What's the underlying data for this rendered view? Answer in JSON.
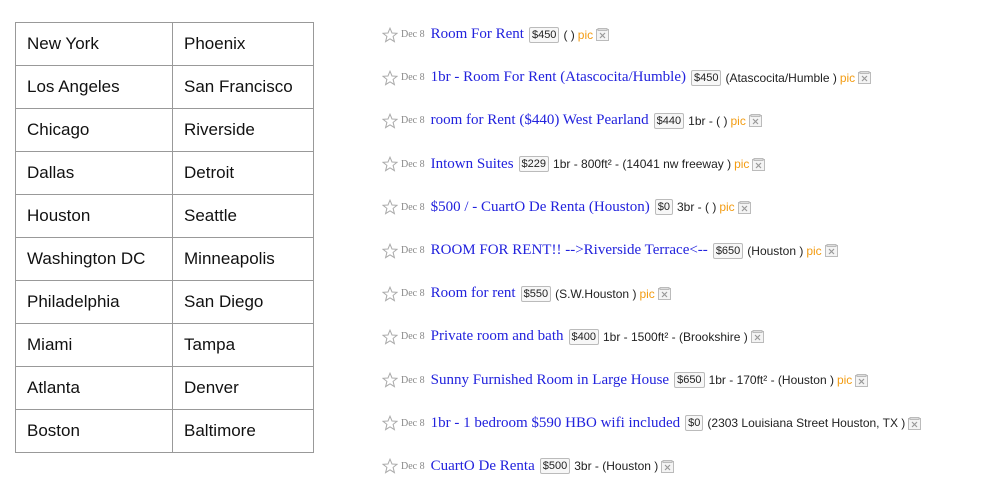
{
  "cities": [
    [
      "New York",
      "Phoenix"
    ],
    [
      "Los Angeles",
      "San Francisco"
    ],
    [
      "Chicago",
      "Riverside"
    ],
    [
      "Dallas",
      "Detroit"
    ],
    [
      "Houston",
      "Seattle"
    ],
    [
      "Washington DC",
      "Minneapolis"
    ],
    [
      "Philadelphia",
      "San Diego"
    ],
    [
      "Miami",
      "Tampa"
    ],
    [
      "Atlanta",
      "Denver"
    ],
    [
      "Boston",
      "Baltimore"
    ]
  ],
  "listings": [
    {
      "date": "Dec 8",
      "title": "Room For Rent",
      "price": "$450",
      "info": "( )",
      "pic": "pic"
    },
    {
      "date": "Dec 8",
      "title": "1br - Room For Rent (Atascocita/Humble)",
      "price": "$450",
      "info": "(Atascocita/Humble )",
      "pic": "pic"
    },
    {
      "date": "Dec 8",
      "title": "room for Rent ($440) West Pearland",
      "price": "$440",
      "info": "1br - ( )",
      "pic": "pic"
    },
    {
      "date": "Dec 8",
      "title": "Intown Suites",
      "price": "$229",
      "info": "1br - 800ft² - (14041 nw freeway )",
      "pic": "pic"
    },
    {
      "date": "Dec 8",
      "title": "$500 / - CuartO De Renta (Houston)",
      "price": "$0",
      "info": "3br - ( )",
      "pic": "pic"
    },
    {
      "date": "Dec 8",
      "title": "ROOM FOR RENT!! -->Riverside Terrace<--",
      "price": "$650",
      "info": "(Houston )",
      "pic": "pic"
    },
    {
      "date": "Dec 8",
      "title": "Room for rent",
      "price": "$550",
      "info": "(S.W.Houston )",
      "pic": "pic"
    },
    {
      "date": "Dec 8",
      "title": "Private room and bath",
      "price": "$400",
      "info": "1br - 1500ft² - (Brookshire )",
      "pic": ""
    },
    {
      "date": "Dec 8",
      "title": "Sunny Furnished Room in Large House",
      "price": "$650",
      "info": "1br - 170ft² - (Houston )",
      "pic": "pic"
    },
    {
      "date": "Dec 8",
      "title": "1br - 1 bedroom $590 HBO wifi included",
      "price": "$0",
      "info": "(2303 Louisiana Street Houston, TX )",
      "pic": ""
    },
    {
      "date": "Dec 8",
      "title": "CuartO De Renta",
      "price": "$500",
      "info": "3br - (Houston )",
      "pic": ""
    }
  ],
  "icons": {
    "favorite": "star-outline-icon",
    "hide": "hide-x-icon"
  },
  "colors": {
    "link": "#2222dd",
    "pic": "#f39c12",
    "date": "#888888"
  }
}
